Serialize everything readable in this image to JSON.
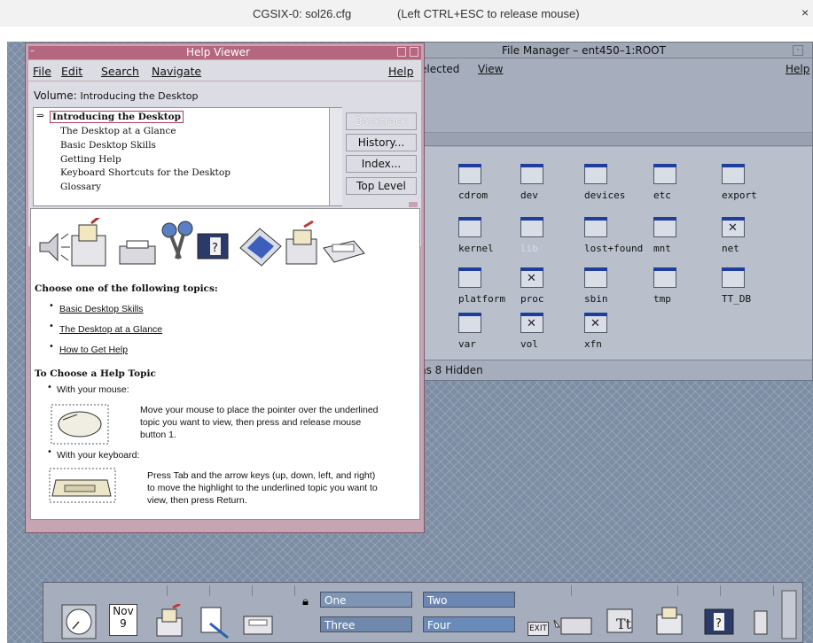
{
  "host": {
    "session": "CGSIX-0: sol26.cfg",
    "hint": "(Left CTRL+ESC to release mouse)",
    "close_label": "×"
  },
  "file_manager": {
    "title": "File Manager – ent450–1:ROOT",
    "menu": {
      "selected": "elected",
      "view": "View",
      "help": "Help"
    },
    "folders": [
      {
        "name": "cdrom",
        "locked": false,
        "dim": false
      },
      {
        "name": "dev",
        "locked": false,
        "dim": false
      },
      {
        "name": "devices",
        "locked": false,
        "dim": false
      },
      {
        "name": "etc",
        "locked": false,
        "dim": false
      },
      {
        "name": "export",
        "locked": false,
        "dim": false
      },
      {
        "name": "kernel",
        "locked": false,
        "dim": false
      },
      {
        "name": "lib",
        "locked": false,
        "dim": true
      },
      {
        "name": "lost+found",
        "locked": false,
        "dim": false
      },
      {
        "name": "mnt",
        "locked": false,
        "dim": false
      },
      {
        "name": "net",
        "locked": true,
        "dim": false
      },
      {
        "name": "platform",
        "locked": false,
        "dim": false
      },
      {
        "name": "proc",
        "locked": true,
        "dim": false
      },
      {
        "name": "sbin",
        "locked": false,
        "dim": false
      },
      {
        "name": "tmp",
        "locked": false,
        "dim": false
      },
      {
        "name": "TT_DB",
        "locked": false,
        "dim": false
      },
      {
        "name": "var",
        "locked": false,
        "dim": false
      },
      {
        "name": "vol",
        "locked": true,
        "dim": false
      },
      {
        "name": "xfn",
        "locked": true,
        "dim": false
      }
    ],
    "status": "ns 8 Hidden"
  },
  "help_viewer": {
    "title": "Help Viewer",
    "menu": {
      "file": "File",
      "edit": "Edit",
      "search": "Search",
      "navigate": "Navigate",
      "help": "Help"
    },
    "volume_label": "Volume:",
    "volume_value": "Introducing the Desktop",
    "topic_arrow": "⇒",
    "topics": [
      "Introducing the Desktop",
      "The Desktop at a Glance",
      "Basic Desktop Skills",
      "Getting Help",
      "Keyboard Shortcuts for the Desktop",
      "Glossary"
    ],
    "buttons": {
      "backtrack": "Backtrack",
      "history": "History...",
      "index": "Index...",
      "top_level": "Top Level"
    },
    "choose_heading": "Choose one of the following topics:",
    "links": [
      "Basic Desktop Skills",
      "The Desktop at a Glance",
      "How to Get Help"
    ],
    "choose_topic_heading": "To Choose a Help Topic",
    "mouse_label": "With your mouse:",
    "mouse_text_1": "Move your mouse to place the pointer over the underlined",
    "mouse_text_2": "topic you want to view, then press and release mouse",
    "mouse_text_3": "button 1.",
    "keyboard_label": "With your keyboard:",
    "keyboard_text_1": "Press Tab and the arrow keys (up, down, left, and right)",
    "keyboard_text_2": "to move the highlight to the underlined topic you want to",
    "keyboard_text_3": "view, then press Return."
  },
  "front_panel": {
    "calendar_month": "Nov",
    "calendar_day": "9",
    "workspaces": [
      "One",
      "Two",
      "Three",
      "Four"
    ],
    "exit_label": "EXIT"
  },
  "colors": {
    "desktop": "#7d8ea4",
    "help_frame": "#c7a4b2",
    "help_title_active": "#b4677f",
    "file_manager_frame": "#a6aebd"
  }
}
